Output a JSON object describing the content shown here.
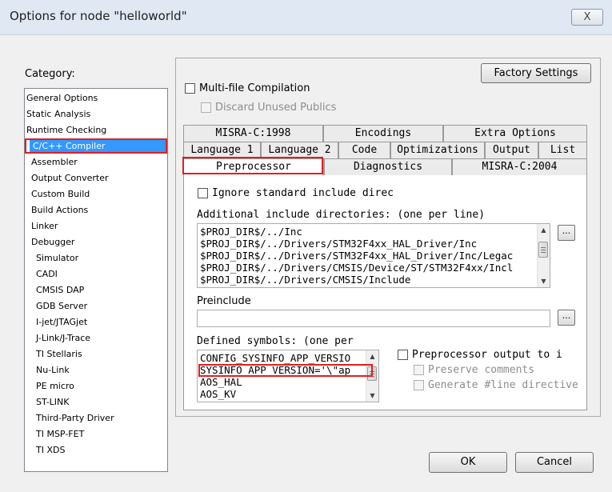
{
  "window": {
    "title": "Options for node \"helloworld\"",
    "close_label": "X"
  },
  "category": {
    "label": "Category:",
    "items": [
      "General Options",
      "Static Analysis",
      "Runtime Checking",
      "C/C++ Compiler",
      "Assembler",
      "Output Converter",
      "Custom Build",
      "Build Actions",
      "Linker",
      "Debugger",
      "Simulator",
      "CADI",
      "CMSIS DAP",
      "GDB Server",
      "I-jet/JTAGjet",
      "J-Link/J-Trace",
      "TI Stellaris",
      "Nu-Link",
      "PE micro",
      "ST-LINK",
      "Third-Party Driver",
      "TI MSP-FET",
      "TI XDS"
    ],
    "selected": "C/C++ Compiler"
  },
  "factory_settings_label": "Factory Settings",
  "multi_file_compilation": "Multi-file Compilation",
  "discard_unused_publics": "Discard Unused Publics",
  "tabs": {
    "row1": [
      "MISRA-C:1998",
      "Encodings",
      "Extra Options"
    ],
    "row2": [
      "Language 1",
      "Language 2",
      "Code",
      "Optimizations",
      "Output",
      "List"
    ],
    "row3": [
      "Preprocessor",
      "Diagnostics",
      "MISRA-C:2004"
    ],
    "active": "Preprocessor"
  },
  "preprocessor": {
    "ignore_std_include": "Ignore standard include direc",
    "additional_include_label": "Additional include directories: (one per line)",
    "include_dirs": [
      "$PROJ_DIR$/../Inc",
      "$PROJ_DIR$/../Drivers/STM32F4xx_HAL_Driver/Inc",
      "$PROJ_DIR$/../Drivers/STM32F4xx_HAL_Driver/Inc/Legac",
      "$PROJ_DIR$/../Drivers/CMSIS/Device/ST/STM32F4xx/Incl",
      "$PROJ_DIR$/../Drivers/CMSIS/Include"
    ],
    "browse_label": "...",
    "preinclude_label": "Preinclude",
    "preinclude_value": "",
    "defined_symbols_label": "Defined symbols: (one per",
    "symbols": [
      "CONFIG_SYSINFO_APP_VERSIO",
      "SYSINFO_APP_VERSION='\\\"ap",
      "AOS_HAL",
      "AOS_KV"
    ],
    "preprocessor_output": "Preprocessor output to i",
    "preserve_comments": "Preserve comments",
    "generate_line_directive": "Generate #line directive"
  },
  "buttons": {
    "ok": "OK",
    "cancel": "Cancel"
  },
  "colors": {
    "selection": "#3399ff",
    "highlight_box": "#e02020"
  }
}
